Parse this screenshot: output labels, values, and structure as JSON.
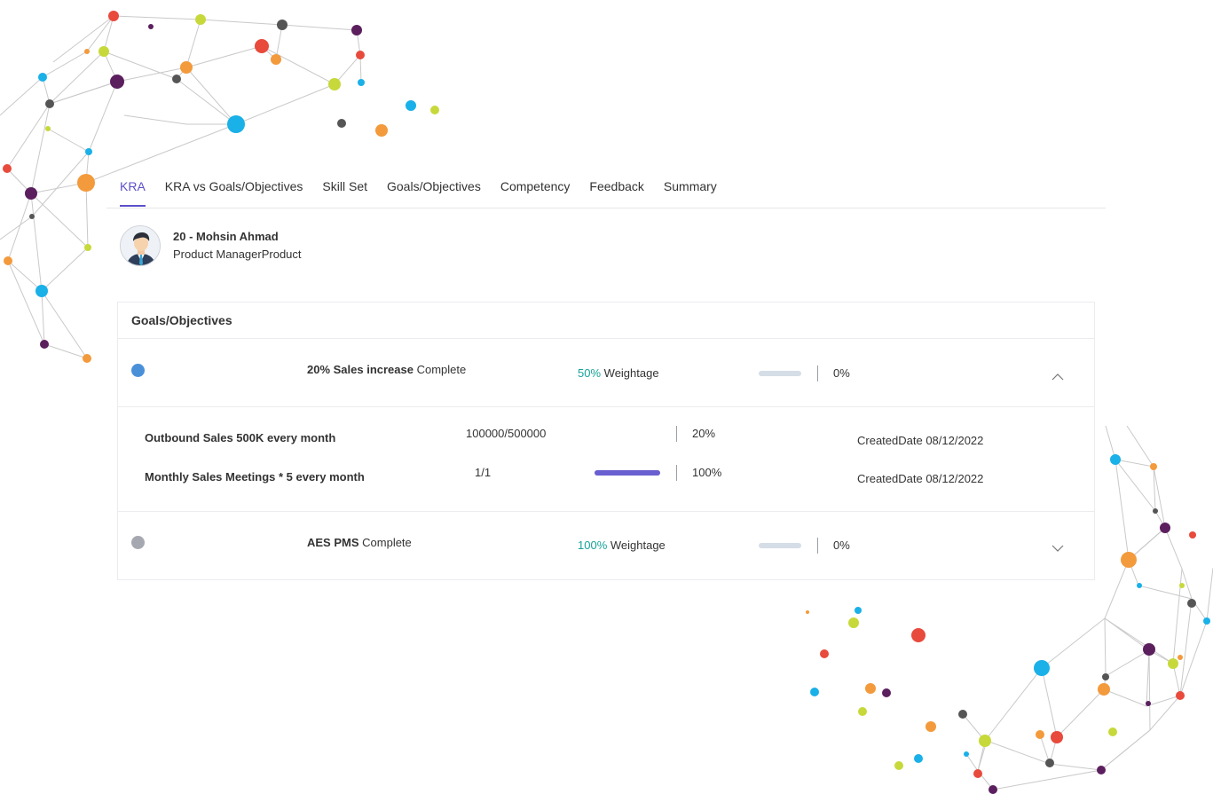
{
  "tabs": [
    {
      "label": "KRA",
      "active": true
    },
    {
      "label": "KRA vs Goals/Objectives",
      "active": false
    },
    {
      "label": "Skill Set",
      "active": false
    },
    {
      "label": "Goals/Objectives",
      "active": false
    },
    {
      "label": "Competency",
      "active": false
    },
    {
      "label": "Feedback",
      "active": false
    },
    {
      "label": "Summary",
      "active": false
    }
  ],
  "employee": {
    "name": "20 - Mohsin Ahmad",
    "role": "Product ManagerProduct"
  },
  "panel": {
    "title": "Goals/Objectives",
    "goals": [
      {
        "name": "20% Sales increase",
        "status": "Complete",
        "weight_pct": "50%",
        "weight_label": "Weightage",
        "progress_percent": 0,
        "progress_text": "0%",
        "dot_color": "#4a90d9",
        "expanded": true,
        "chevron": "chevron-up-icon",
        "objectives": [
          {
            "name": "Outbound Sales 500K every month",
            "ratio": "100000/500000",
            "progress_percent": 20,
            "progress_text": "20%",
            "created": "CreatedDate 08/12/2022",
            "bar_visible": false
          },
          {
            "name": "Monthly Sales Meetings * 5 every month",
            "ratio": "1/1",
            "progress_percent": 100,
            "progress_text": "100%",
            "created": "CreatedDate 08/12/2022",
            "bar_visible": true
          }
        ]
      },
      {
        "name": "AES PMS",
        "status": "Complete",
        "weight_pct": "100%",
        "weight_label": "Weightage",
        "progress_percent": 0,
        "progress_text": "0%",
        "dot_color": "#a5a8b0",
        "expanded": false,
        "chevron": "chevron-down-icon"
      }
    ]
  },
  "colors": {
    "accent": "#5b4fc9",
    "weight_green": "#16a39a",
    "bar_fill": "#6a5fd0",
    "bar_track": "#d5dde6"
  }
}
